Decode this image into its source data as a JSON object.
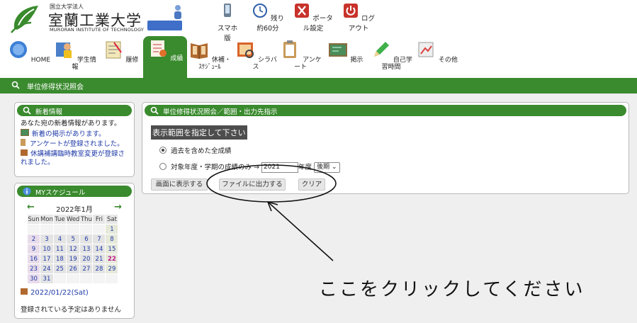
{
  "header": {
    "univ_small": "国立大学法人",
    "univ_name": "室蘭工業大学",
    "univ_en": "MURORAN INSTITUTE OF TECHNOLOGY",
    "tools": [
      {
        "label": "スマホ版",
        "icon": "smartphone-icon"
      },
      {
        "label": "残り約60分",
        "icon": "clock-icon"
      },
      {
        "label": "ポータル設定",
        "icon": "tools-icon"
      },
      {
        "label": "ログアウト",
        "icon": "power-icon"
      }
    ]
  },
  "nav": [
    {
      "label": "HOME",
      "icon": "home-icon"
    },
    {
      "label": "学生情報",
      "icon": "student-icon"
    },
    {
      "label": "履修",
      "icon": "notebook-icon"
    },
    {
      "label": "成績",
      "icon": "grades-icon",
      "active": true
    },
    {
      "label": "休補・ｽｹｼﾞｭｰﾙ",
      "icon": "schedule-book-icon"
    },
    {
      "label": "シラバス",
      "icon": "syllabus-icon"
    },
    {
      "label": "アンケート",
      "icon": "clipboard-icon"
    },
    {
      "label": "掲示",
      "icon": "board-icon"
    },
    {
      "label": "自己学習時間",
      "icon": "pencil-icon"
    },
    {
      "label": "その他",
      "icon": "other-icon"
    }
  ],
  "page_bar": "単位修得状況照会",
  "news": {
    "title": "新着情報",
    "intro": "あなた宛の新着情報があります。",
    "items": [
      "新着の掲示があります。",
      "アンケートが登録されました。",
      "休講補講臨時教室変更が登録されました。"
    ]
  },
  "schedule": {
    "title": "MYスケジュール",
    "month": "2022年1月",
    "weekdays": [
      "Sun",
      "Mon",
      "Tue",
      "Wed",
      "Thu",
      "Fri",
      "Sat"
    ],
    "weeks": [
      [
        "",
        "",
        "",
        "",
        "",
        "",
        "1"
      ],
      [
        "2",
        "3",
        "4",
        "5",
        "6",
        "7",
        "8"
      ],
      [
        "9",
        "10",
        "11",
        "12",
        "13",
        "14",
        "15"
      ],
      [
        "16",
        "17",
        "18",
        "19",
        "20",
        "21",
        "22"
      ],
      [
        "23",
        "24",
        "25",
        "26",
        "27",
        "28",
        "29"
      ],
      [
        "30",
        "31",
        "",
        "",
        "",
        "",
        ""
      ]
    ],
    "today": "22",
    "selected_date": "2022/01/22(Sat)",
    "no_events": "登録されている予定はありません"
  },
  "main": {
    "title": "単位修得状況照会／範囲・出力先指示",
    "prompt": "表示範囲を指定して下さい",
    "option_all": "過去を含めた全成績",
    "option_year": "対象年度・学期の成績のみ →",
    "year_value": "2021",
    "year_suffix": "年度",
    "term_value": "後期",
    "buttons": {
      "screen": "画面に表示する",
      "file": "ファイルに出力する",
      "clear": "クリア"
    }
  },
  "annotation": "ここをクリックしてください",
  "colors": {
    "green": "#3a8a2e",
    "link": "#1f3aa8",
    "today": "#c0168f"
  }
}
